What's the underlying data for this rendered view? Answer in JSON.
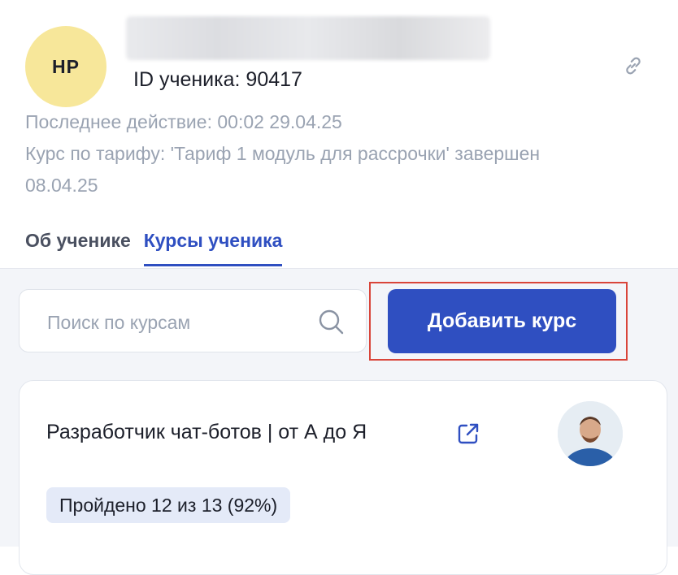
{
  "student": {
    "initials": "НР",
    "id_label": "ID ученика: 90417",
    "last_action": "Последнее действие: 00:02 29.04.25",
    "tariff_status_line1": "Курс по тарифу: 'Тариф 1 модуль для рассрочки' завершен",
    "tariff_status_line2": "08.04.25"
  },
  "tabs": [
    {
      "label": "Об ученике",
      "active": false
    },
    {
      "label": "Курсы ученика",
      "active": true
    }
  ],
  "search": {
    "placeholder": "Поиск по курсам",
    "value": ""
  },
  "actions": {
    "add_course_label": "Добавить курс"
  },
  "course": {
    "title": "Разработчик чат-ботов | от А до Я",
    "progress_label": "Пройдено 12 из 13 (92%)"
  },
  "icons": {
    "copy_link": "link-icon",
    "search": "search-icon",
    "open_course": "external-link-icon"
  },
  "colors": {
    "accent": "#2f4fc1",
    "avatar_bg": "#f7e79a",
    "highlight": "#d9453a",
    "muted_text": "#9aa3b2",
    "progress_bg": "#e4eaf8"
  }
}
